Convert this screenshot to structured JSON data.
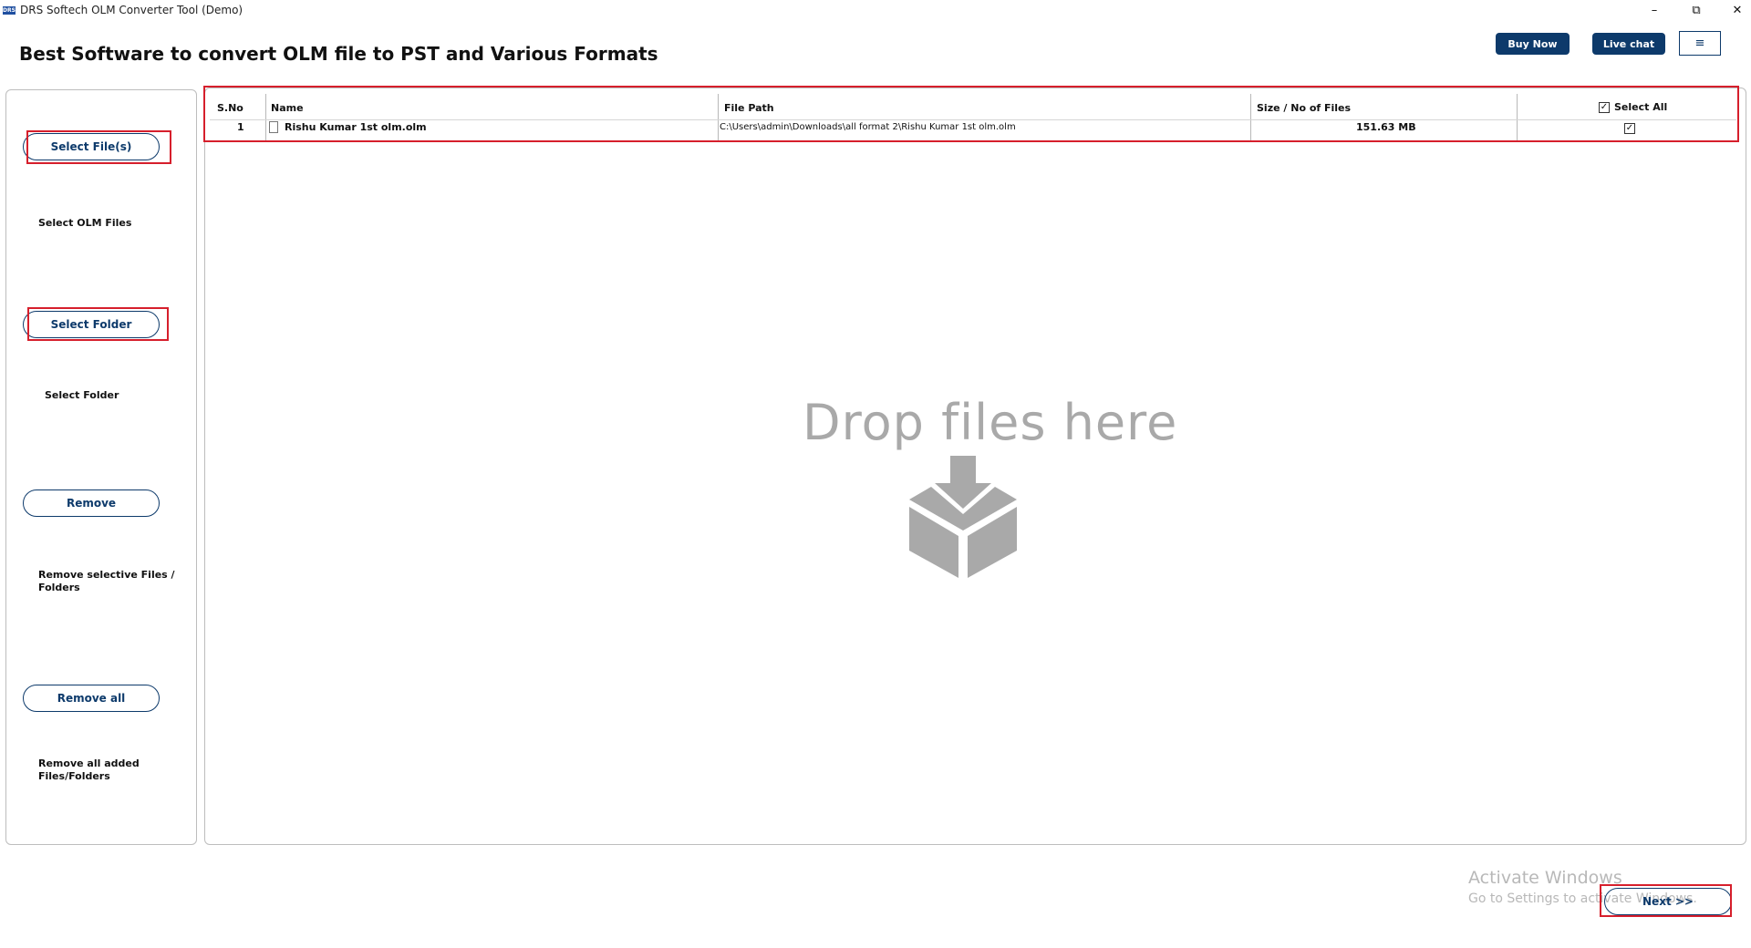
{
  "window": {
    "icon_text": "DRS",
    "title": "DRS Softech OLM Converter Tool (Demo)",
    "minimize": "–",
    "restore": "⧉",
    "close": "✕"
  },
  "header": {
    "title": "Best Software to convert OLM file to PST and Various Formats",
    "buy_now": "Buy Now",
    "live_chat": "Live chat",
    "menu_icon": "≡"
  },
  "sidebar": {
    "select_files_button": "Select File(s)",
    "select_files_desc": "Select OLM Files",
    "select_folder_button": "Select Folder",
    "select_folder_desc": "Select Folder",
    "remove_button": "Remove",
    "remove_desc": "Remove selective Files / Folders",
    "remove_all_button": "Remove all",
    "remove_all_desc": "Remove all added Files/Folders"
  },
  "table": {
    "columns": {
      "sno": "S.No",
      "name": "Name",
      "path": "File Path",
      "size": "Size / No of Files",
      "select_all": "Select All"
    },
    "rows": [
      {
        "sno": "1",
        "name": "Rishu Kumar 1st olm.olm",
        "path": "C:\\Users\\admin\\Downloads\\all format 2\\Rishu Kumar 1st olm.olm",
        "size": "151.63 MB",
        "checked": true
      }
    ]
  },
  "drop_zone": {
    "text": "Drop files here",
    "icon": "download-box-icon"
  },
  "watermark": {
    "line1": "Activate Windows",
    "line2": "Go to Settings to activate Windows."
  },
  "footer": {
    "next": "Next >>"
  },
  "colors": {
    "accent": "#0d3a6b",
    "highlight": "#d61f2c",
    "drop_gray": "#a9a9a9"
  }
}
